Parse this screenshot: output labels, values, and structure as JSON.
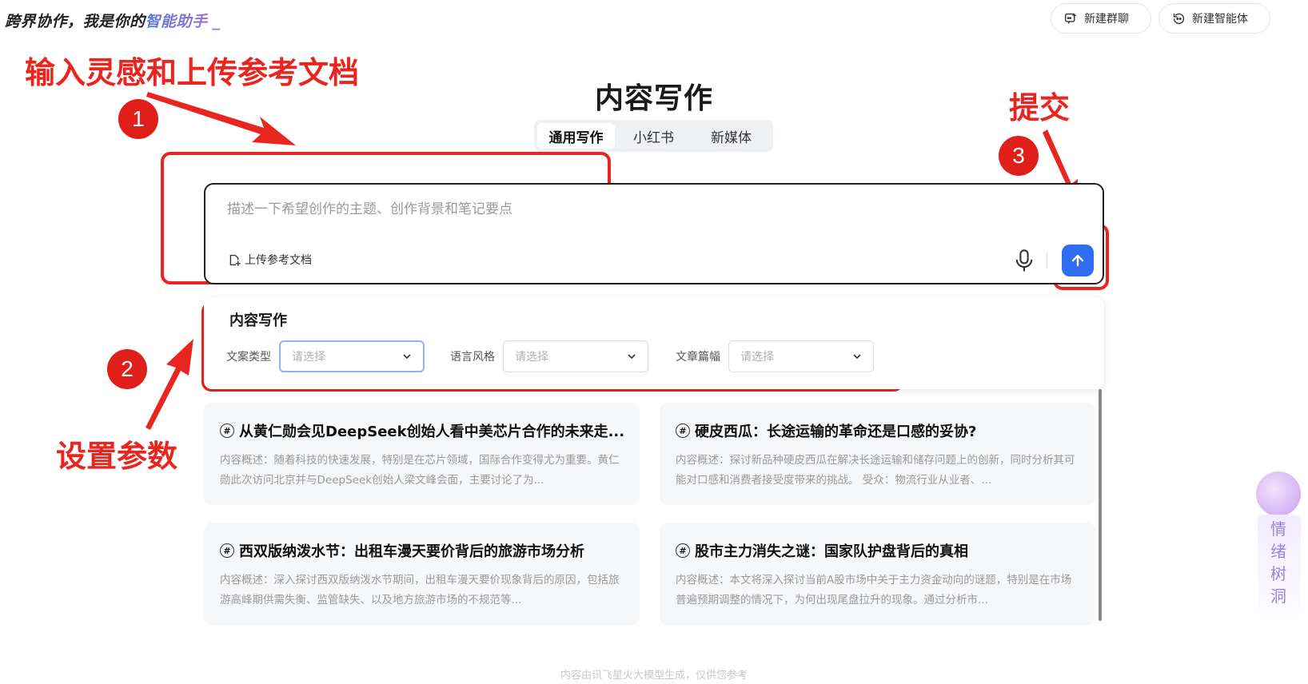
{
  "header": {
    "tagline_prefix": "跨界协作，我是你的",
    "tagline_highlight": "智能助手",
    "tagline_cursor": "_",
    "new_group_label": "新建群聊",
    "new_agent_label": "新建智能体"
  },
  "annotations": {
    "step1_text": "输入灵感和上传参考文档",
    "step2_text": "设置参数",
    "step3_text": "提交",
    "step1_num": "1",
    "step2_num": "2",
    "step3_num": "3",
    "color": "#e8261f"
  },
  "main": {
    "title": "内容写作",
    "tabs": [
      {
        "label": "通用写作",
        "active": true
      },
      {
        "label": "小红书",
        "active": false
      },
      {
        "label": "新媒体",
        "active": false
      }
    ]
  },
  "input": {
    "placeholder": "描述一下希望创作的主题、创作背景和笔记要点",
    "upload_label": "上传参考文档",
    "accent": "#2f6df2"
  },
  "params": {
    "title": "内容写作",
    "fields": [
      {
        "label": "文案类型",
        "placeholder": "请选择"
      },
      {
        "label": "语言风格",
        "placeholder": "请选择"
      },
      {
        "label": "文章篇幅",
        "placeholder": "请选择"
      }
    ]
  },
  "cards": [
    {
      "title": "从黄仁勋会见DeepSeek创始人看中美芯片合作的未来走...",
      "desc": "内容概述：随着科技的快速发展，特别是在芯片领域，国际合作变得尤为重要。黄仁勋此次访问北京并与DeepSeek创始人梁文峰会面，主要讨论了为..."
    },
    {
      "title": "硬皮西瓜：长途运输的革命还是口感的妥协?",
      "desc": "内容概述：探讨新品种硬皮西瓜在解决长途运输和储存问题上的创新，同时分析其可能对口感和消费者接受度带来的挑战。 受众：物流行业从业者、..."
    },
    {
      "title": "西双版纳泼水节：出租车漫天要价背后的旅游市场分析",
      "desc": "内容概述：深入探讨西双版纳泼水节期间，出租车漫天要价现象背后的原因，包括旅游高峰期供需失衡、监管缺失、以及地方旅游市场的不规范等..."
    },
    {
      "title": "股市主力消失之谜：国家队护盘背后的真相",
      "desc": "内容概述：本文将深入探讨当前A股市场中关于主力资金动向的谜题，特别是在市场普遍预期调整的情况下，为何出现尾盘拉升的现象。通过分析市..."
    }
  ],
  "side_widget": {
    "label": "情绪树洞"
  },
  "footer": {
    "text": "内容由讯飞星火大模型生成，仅供您参考"
  }
}
